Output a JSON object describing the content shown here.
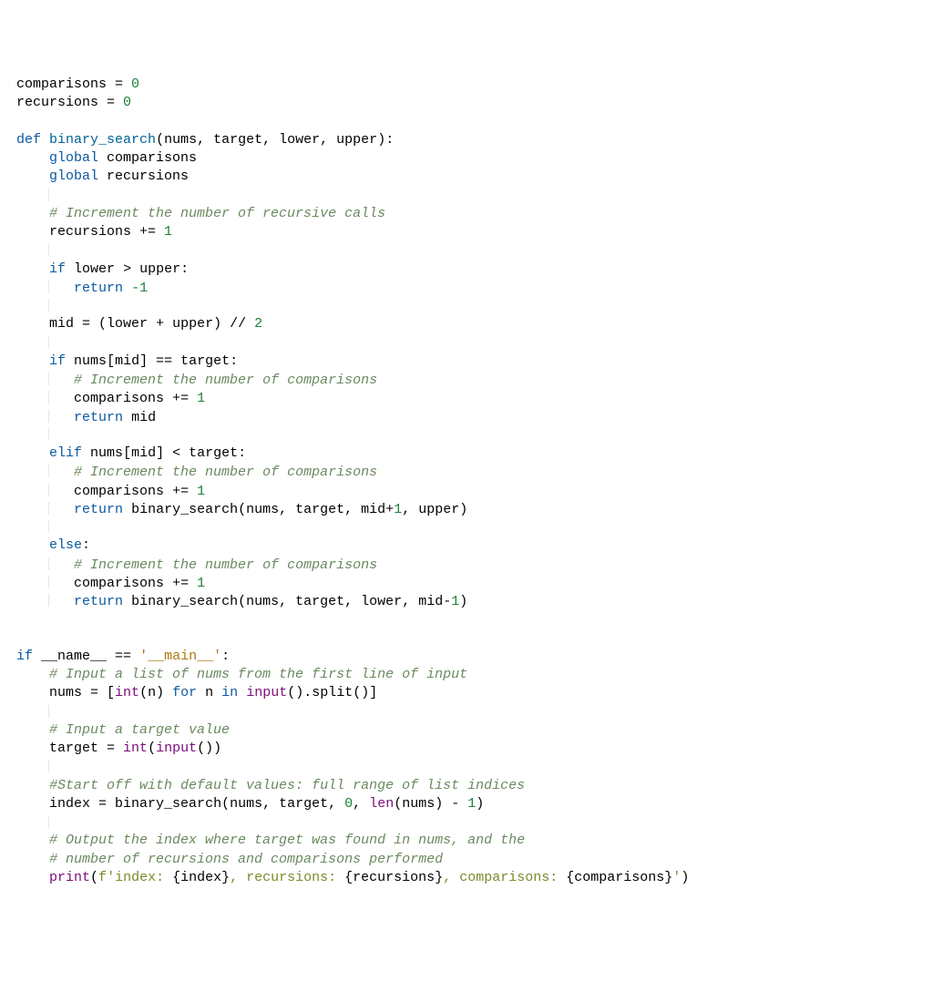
{
  "kw": {
    "def": "def",
    "global": "global",
    "if": "if",
    "elif": "elif",
    "else": "else",
    "return": "return",
    "for": "for",
    "in": "in"
  },
  "ident": {
    "comparisons": "comparisons",
    "recursions": "recursions",
    "binary_search": "binary_search",
    "nums": "nums",
    "target": "target",
    "lower": "lower",
    "upper": "upper",
    "mid": "mid",
    "n": "n",
    "index": "index",
    "name": "__name__"
  },
  "builtin": {
    "int": "int",
    "input": "input",
    "len": "len",
    "print": "print"
  },
  "num": {
    "zero": "0",
    "one": "1",
    "neg1": "-1",
    "two": "2"
  },
  "cmt": {
    "c1": "# Increment the number of recursive calls",
    "c2": "# Increment the number of comparisons",
    "c3": "# Input a list of nums from the first line of input",
    "c4": "# Input a target value",
    "c5": "#Start off with default values: full range of list indices",
    "c6": "# Output the index where target was found in nums, and the",
    "c7": "# number of recursions and comparisons performed"
  },
  "str": {
    "main": "'__main__'",
    "f_prefix": "f",
    "f_open": "'index: ",
    "f_mid1": ", recursions: ",
    "f_mid2": ", comparisons: ",
    "f_close": "'"
  },
  "gut": {
    "g1": "",
    "g2": "",
    "g3": "",
    "g4": "",
    "g5": "",
    "g6": "",
    "g7": "",
    "g8": "",
    "g9": "",
    "g10": "",
    "g11": "",
    "g12": "",
    "g13": "",
    "g14": "",
    "g15": "",
    "g16": "",
    "g17": "",
    "g18": "",
    "g19": "",
    "g20": "",
    "g21": "",
    "g22": "",
    "g23": "",
    "g24": "",
    "g25": "",
    "g26": "",
    "g27": "",
    "g28": "",
    "g29": "",
    "g30": "",
    "g31": "",
    "g32": "",
    "g33": "",
    "g34": "",
    "g35": "",
    "g36": "",
    "g37": "",
    "g38": "",
    "g39": "",
    "g40": "",
    "g41": "",
    "g42": "",
    "g43": "",
    "g44": ""
  }
}
